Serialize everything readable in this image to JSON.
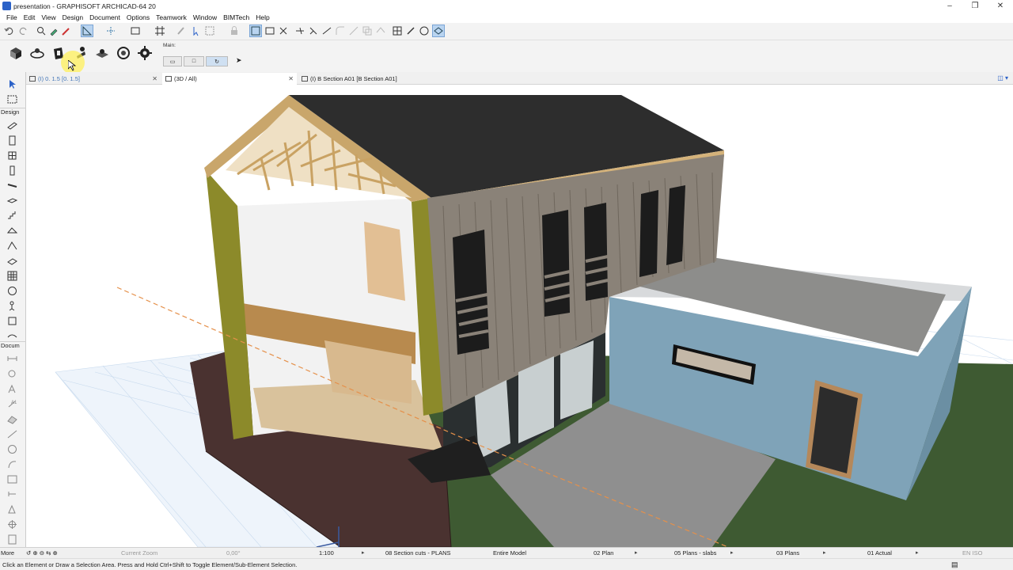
{
  "window": {
    "title": "presentation - GRAPHISOFT ARCHICAD-64 20"
  },
  "menu": [
    "File",
    "Edit",
    "View",
    "Design",
    "Document",
    "Options",
    "Teamwork",
    "Window",
    "BIMTech",
    "Help"
  ],
  "toolbar2": {
    "main_label": "Main:"
  },
  "tabs": [
    {
      "label": "(I) 0. 1.5 [0. 1.5]",
      "active": false
    },
    {
      "label": "(3D / All)",
      "active": true
    },
    {
      "label": "(I) B Section A01 [B Section A01]",
      "active": false
    }
  ],
  "toolbox": {
    "design_label": "Design",
    "document_label": "Docum",
    "more_label": "More"
  },
  "status": {
    "zoom_label": "Current Zoom",
    "angle": "0,00°",
    "scale": "1:100",
    "layer_combo": "08 Section cuts - PLANS",
    "model_view": "Entire Model",
    "pen_set": "02 Plan",
    "mvo": "05 Plans - slabs",
    "dim_style": "03 Plans",
    "renovation": "01 Actual",
    "lang": "EN ISO"
  },
  "hint": "Click an Element or Draw a Selection Area. Press and Hold Ctrl+Shift to Toggle Element/Sub-Element Selection.",
  "colors": {
    "accent": "#2b62c8",
    "wall_blue": "#7fa3b8",
    "roof": "#2d2d2d",
    "grass": "#3e5a32"
  }
}
